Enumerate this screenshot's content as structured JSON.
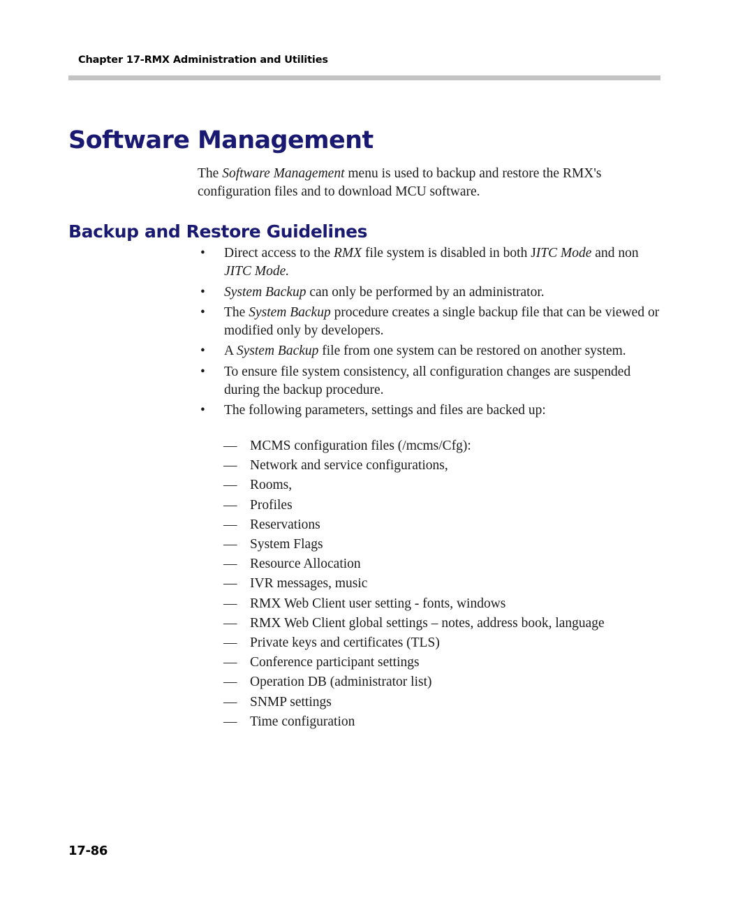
{
  "header": {
    "running_head": "Chapter 17-RMX Administration and Utilities"
  },
  "titles": {
    "main": "Software Management",
    "sub": "Backup and Restore Guidelines"
  },
  "intro": {
    "before": "The ",
    "emphasis": "Software Management",
    "after": " menu is used to backup and restore the RMX's configuration files and to download MCU software."
  },
  "bullets": [
    {
      "marker": "•",
      "parts": [
        {
          "text": "Direct access to the ",
          "italic": false
        },
        {
          "text": "RMX",
          "italic": true
        },
        {
          "text": " file system is disabled in both J",
          "italic": false
        },
        {
          "text": "ITC Mode",
          "italic": true
        },
        {
          "text": " and non ",
          "italic": false
        },
        {
          "text": "JITC Mode.",
          "italic": true
        }
      ]
    },
    {
      "marker": "•",
      "parts": [
        {
          "text": "System Backup",
          "italic": true
        },
        {
          "text": " can only be performed by an administrator.",
          "italic": false
        }
      ]
    },
    {
      "marker": "•",
      "parts": [
        {
          "text": "The ",
          "italic": false
        },
        {
          "text": "System Backup",
          "italic": true
        },
        {
          "text": " procedure creates a single backup file that can be viewed or modified only by developers.",
          "italic": false
        }
      ]
    },
    {
      "marker": "•",
      "parts": [
        {
          "text": "A ",
          "italic": false
        },
        {
          "text": "System Backup",
          "italic": true
        },
        {
          "text": " file from one system can be restored on another system.",
          "italic": false
        }
      ]
    },
    {
      "marker": "•",
      "parts": [
        {
          "text": "To ensure file system consistency, all configuration changes are suspended during the backup procedure.",
          "italic": false
        }
      ]
    },
    {
      "marker": "•",
      "parts": [
        {
          "text": "The following parameters, settings and files are backed up:",
          "italic": false
        }
      ]
    }
  ],
  "dash_marker": "—",
  "dash_items": [
    "MCMS configuration files (/mcms/Cfg):",
    "Network and service configurations,",
    "Rooms,",
    "Profiles",
    "Reservations",
    "System Flags",
    "Resource Allocation",
    "IVR messages, music",
    "RMX Web Client user setting - fonts, windows",
    "RMX Web Client global settings – notes, address book, language",
    "Private keys and certificates (TLS)",
    "Conference participant settings",
    "Operation DB (administrator list)",
    "SNMP settings",
    "Time configuration"
  ],
  "footer": {
    "page_number": "17-86"
  },
  "colors": {
    "heading": "#191971",
    "rule": "#c3c3c3",
    "body_text": "#1a1a1a"
  }
}
